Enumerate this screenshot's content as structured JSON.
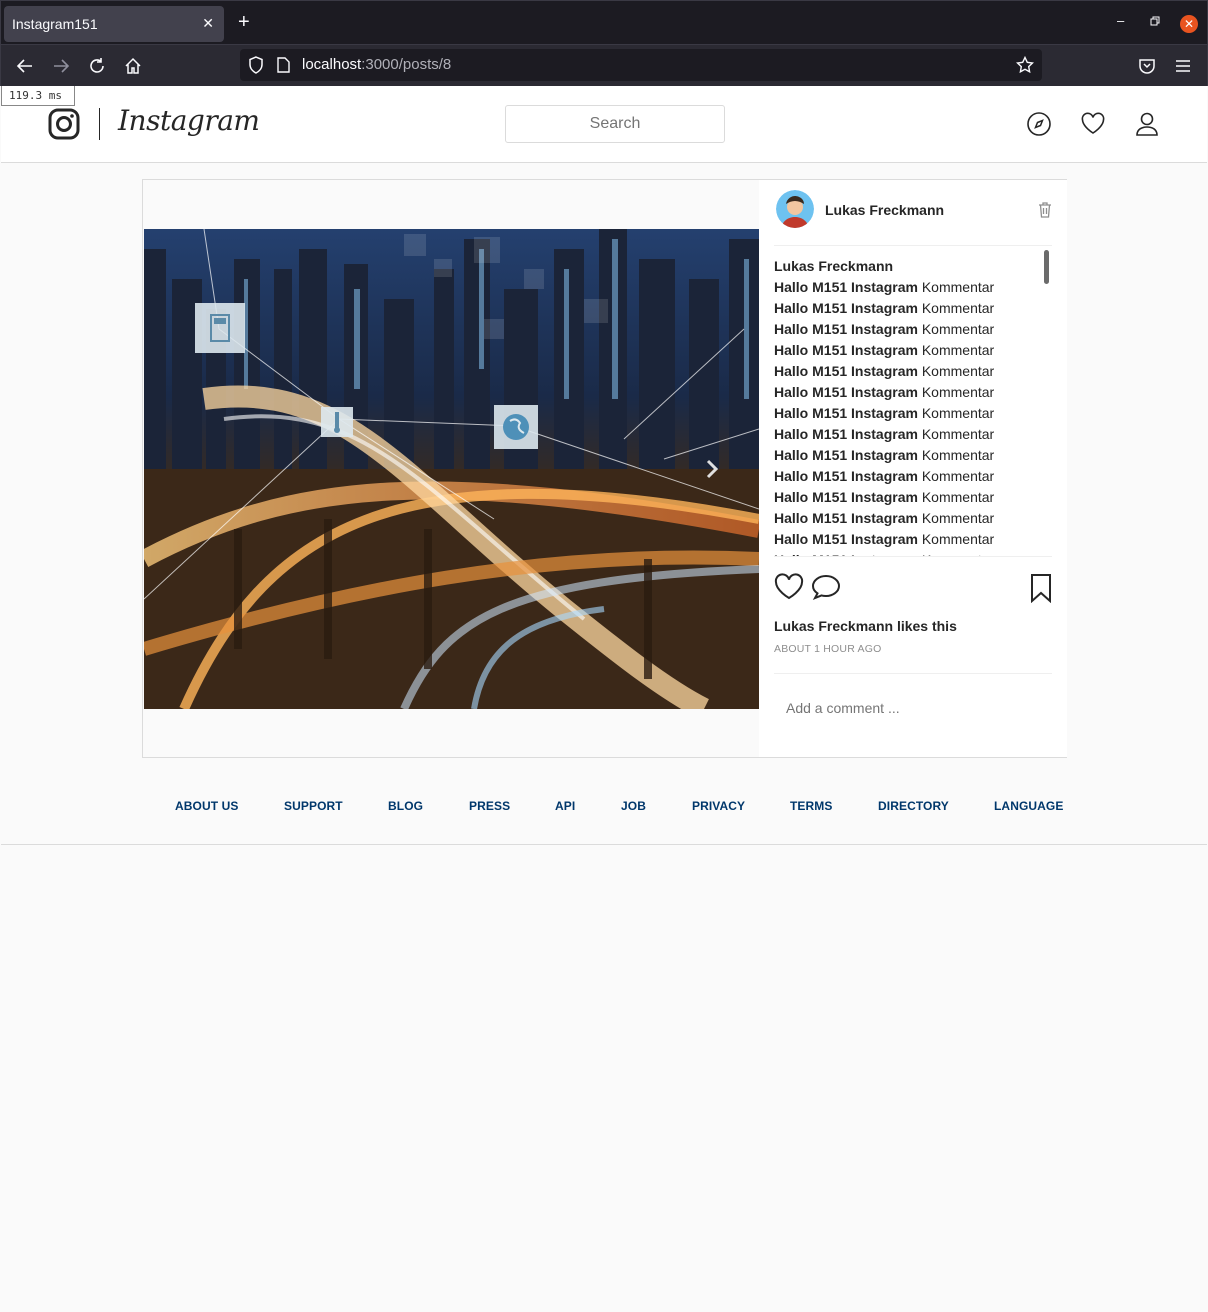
{
  "browser": {
    "tab_title": "Instagram151",
    "url_host": "localhost",
    "url_path": ":3000/posts/8"
  },
  "timing": "119.3 ms",
  "header": {
    "wordmark": "Instagram",
    "search_placeholder": "Search"
  },
  "post": {
    "author": "Lukas Freckmann",
    "caption_author": "Lukas Freckmann",
    "comments": [
      {
        "user": "Hallo M151 Instagram",
        "text": "Kommentar"
      },
      {
        "user": "Hallo M151 Instagram",
        "text": "Kommentar"
      },
      {
        "user": "Hallo M151 Instagram",
        "text": "Kommentar"
      },
      {
        "user": "Hallo M151 Instagram",
        "text": "Kommentar"
      },
      {
        "user": "Hallo M151 Instagram",
        "text": "Kommentar"
      },
      {
        "user": "Hallo M151 Instagram",
        "text": "Kommentar"
      },
      {
        "user": "Hallo M151 Instagram",
        "text": "Kommentar"
      },
      {
        "user": "Hallo M151 Instagram",
        "text": "Kommentar"
      },
      {
        "user": "Hallo M151 Instagram",
        "text": "Kommentar"
      },
      {
        "user": "Hallo M151 Instagram",
        "text": "Kommentar"
      },
      {
        "user": "Hallo M151 Instagram",
        "text": "Kommentar"
      },
      {
        "user": "Hallo M151 Instagram",
        "text": "Kommentar"
      },
      {
        "user": "Hallo M151 Instagram",
        "text": "Kommentar"
      },
      {
        "user": "Hallo M151 Instagram",
        "text": "Kommentar"
      }
    ],
    "likes_text": "Lukas Freckmann likes this",
    "time_ago": "ABOUT 1 HOUR AGO",
    "comment_placeholder": "Add a comment ..."
  },
  "footer": {
    "links": [
      "ABOUT US",
      "SUPPORT",
      "BLOG",
      "PRESS",
      "API",
      "JOB",
      "PRIVACY",
      "TERMS",
      "DIRECTORY",
      "LANGUAGE"
    ]
  },
  "colors": {
    "link": "#00376b",
    "border": "#dbdbdb",
    "chrome_dark": "#1c1b22",
    "close_orange": "#e95420"
  }
}
